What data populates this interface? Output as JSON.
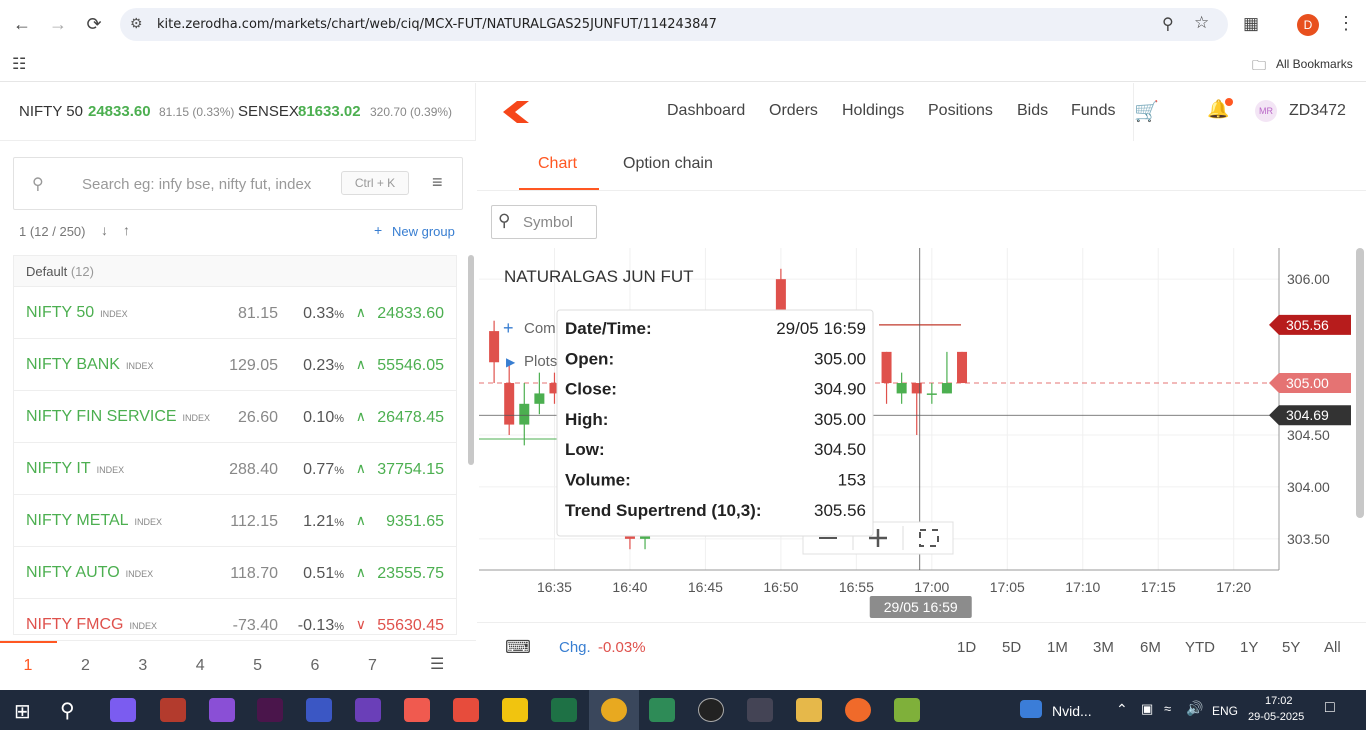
{
  "browser": {
    "url": "kite.zerodha.com/markets/chart/web/ciq/MCX-FUT/NATURALGAS25JUNFUT/114243847",
    "profile_initial": "D",
    "bookmarks_label": "All Bookmarks"
  },
  "index_bar": [
    {
      "name": "NIFTY 50",
      "value": "24833.60",
      "change": "81.15 (0.33%)"
    },
    {
      "name": "SENSEX",
      "value": "81633.02",
      "change": "320.70 (0.39%)"
    }
  ],
  "search": {
    "placeholder": "Search eg: infy bse, nifty fut, index",
    "shortcut": "Ctrl + K"
  },
  "watchlist_meta": {
    "count": "1 (12 / 250)",
    "new_group": "New group"
  },
  "watchlist_group": {
    "name": "Default",
    "count": "(12)"
  },
  "watchlist": [
    {
      "name": "NIFTY 50",
      "tag": "INDEX",
      "change": "81.15",
      "pct": "0.33",
      "dir": "up",
      "ltp": "24833.60"
    },
    {
      "name": "NIFTY BANK",
      "tag": "INDEX",
      "change": "129.05",
      "pct": "0.23",
      "dir": "up",
      "ltp": "55546.05"
    },
    {
      "name": "NIFTY FIN SERVICE",
      "tag": "INDEX",
      "change": "26.60",
      "pct": "0.10",
      "dir": "up",
      "ltp": "26478.45"
    },
    {
      "name": "NIFTY IT",
      "tag": "INDEX",
      "change": "288.40",
      "pct": "0.77",
      "dir": "up",
      "ltp": "37754.15"
    },
    {
      "name": "NIFTY METAL",
      "tag": "INDEX",
      "change": "112.15",
      "pct": "1.21",
      "dir": "up",
      "ltp": "9351.65"
    },
    {
      "name": "NIFTY AUTO",
      "tag": "INDEX",
      "change": "118.70",
      "pct": "0.51",
      "dir": "up",
      "ltp": "23555.75"
    },
    {
      "name": "NIFTY FMCG",
      "tag": "INDEX",
      "change": "-73.40",
      "pct": "-0.13",
      "dir": "down",
      "ltp": "55630.45"
    }
  ],
  "pct_suffix": "%",
  "pages": [
    "1",
    "2",
    "3",
    "4",
    "5",
    "6",
    "7"
  ],
  "nav": {
    "links": [
      "Dashboard",
      "Orders",
      "Holdings",
      "Positions",
      "Bids",
      "Funds"
    ],
    "avatar": "MR",
    "user_id": "ZD3472"
  },
  "subtabs": [
    "Chart",
    "Option chain"
  ],
  "symbol_placeholder": "Symbol",
  "chart": {
    "title": "NATURALGAS JUN FUT",
    "menu_items": [
      "Com",
      "Plots"
    ],
    "price_ticks": [
      "306.00",
      "304.50",
      "304.00",
      "303.50"
    ],
    "time_ticks": [
      "16:35",
      "16:40",
      "16:45",
      "16:50",
      "16:55",
      "17:00",
      "17:05",
      "17:10",
      "17:15",
      "17:20"
    ],
    "labels": {
      "supertrend": "305.56",
      "last": "305.00",
      "cursor": "304.69"
    },
    "cursor_time": "29/05 16:59",
    "tooltip": [
      {
        "k": "Date/Time:",
        "v": "29/05 16:59"
      },
      {
        "k": "Open:",
        "v": "305.00"
      },
      {
        "k": "Close:",
        "v": "304.90"
      },
      {
        "k": "High:",
        "v": "305.00"
      },
      {
        "k": "Low:",
        "v": "304.50"
      },
      {
        "k": "Volume:",
        "v": "153"
      },
      {
        "k": "Trend Supertrend (10,3):",
        "v": "305.56"
      }
    ]
  },
  "chart_data": {
    "type": "candlestick",
    "y_range": [
      303.2,
      306.3
    ],
    "x_range": [
      "16:30",
      "17:23"
    ],
    "candles": [
      {
        "t": "16:31",
        "o": 305.5,
        "c": 305.2,
        "h": 305.6,
        "l": 305.0
      },
      {
        "t": "16:32",
        "o": 305.0,
        "c": 304.6,
        "h": 305.2,
        "l": 304.5
      },
      {
        "t": "16:33",
        "o": 304.6,
        "c": 304.8,
        "h": 305.0,
        "l": 304.4
      },
      {
        "t": "16:34",
        "o": 304.8,
        "c": 304.9,
        "h": 305.1,
        "l": 304.7
      },
      {
        "t": "16:35",
        "o": 305.0,
        "c": 304.9,
        "h": 305.1,
        "l": 304.8
      },
      {
        "t": "16:40",
        "o": 303.6,
        "c": 303.5,
        "h": 303.7,
        "l": 303.4
      },
      {
        "t": "16:41",
        "o": 303.5,
        "c": 303.6,
        "h": 303.7,
        "l": 303.4
      },
      {
        "t": "16:50",
        "o": 306.0,
        "c": 305.6,
        "h": 306.1,
        "l": 305.5
      },
      {
        "t": "16:57",
        "o": 305.3,
        "c": 305.0,
        "h": 305.3,
        "l": 304.8
      },
      {
        "t": "16:58",
        "o": 304.9,
        "c": 305.0,
        "h": 305.1,
        "l": 304.8
      },
      {
        "t": "16:59",
        "o": 305.0,
        "c": 304.9,
        "h": 305.0,
        "l": 304.5
      },
      {
        "t": "17:00",
        "o": 304.9,
        "c": 304.9,
        "h": 305.0,
        "l": 304.8
      },
      {
        "t": "17:01",
        "o": 304.9,
        "c": 305.0,
        "h": 305.3,
        "l": 304.9
      },
      {
        "t": "17:02",
        "o": 305.3,
        "c": 305.0,
        "h": 305.3,
        "l": 305.0
      }
    ],
    "supertrend": 305.56,
    "last_price": 305.0
  },
  "bottom": {
    "chg_label": "Chg.",
    "chg_value": "-0.03%",
    "ranges": [
      "1D",
      "5D",
      "1M",
      "3M",
      "6M",
      "YTD",
      "1Y",
      "5Y",
      "All"
    ]
  },
  "taskbar": {
    "nvidia": "Nvid...",
    "lang": "ENG",
    "time": "17:02",
    "date": "29-05-2025"
  },
  "colors": {
    "up": "#4caf50",
    "down": "#df514c",
    "accent": "#ff5722"
  }
}
